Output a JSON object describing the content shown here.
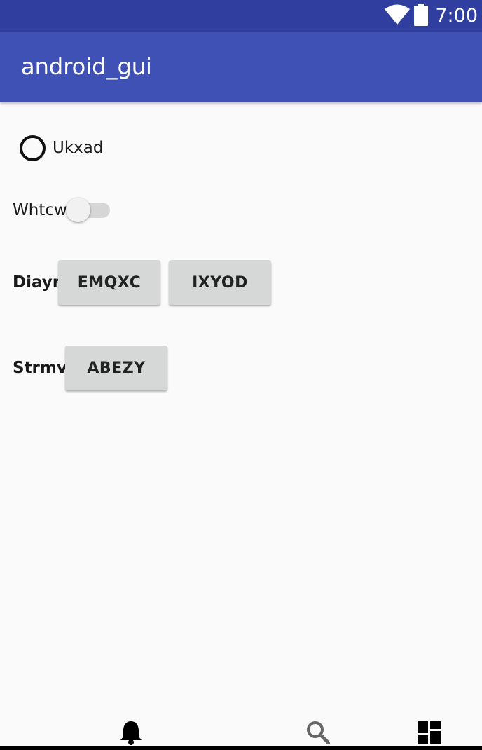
{
  "status_bar": {
    "time": "7:00",
    "icons": [
      "wifi-icon",
      "battery-icon"
    ]
  },
  "app_bar": {
    "title": "android_gui"
  },
  "radio": {
    "label": "Ukxad",
    "checked": false
  },
  "switch": {
    "label": "Whtcw",
    "on": false
  },
  "button_row_1": {
    "label": "Diayr",
    "buttons": [
      "EMQXC",
      "IXYOD"
    ]
  },
  "button_row_2": {
    "label": "Strmv",
    "buttons": [
      "ABEZY"
    ]
  },
  "bottom_nav": {
    "items": [
      "bell-icon",
      "search-icon",
      "dashboard-icon"
    ]
  },
  "colors": {
    "status_bar": "#303f9f",
    "app_bar": "#3f51b5",
    "background": "#fafafa",
    "button": "#d6d7d7"
  }
}
